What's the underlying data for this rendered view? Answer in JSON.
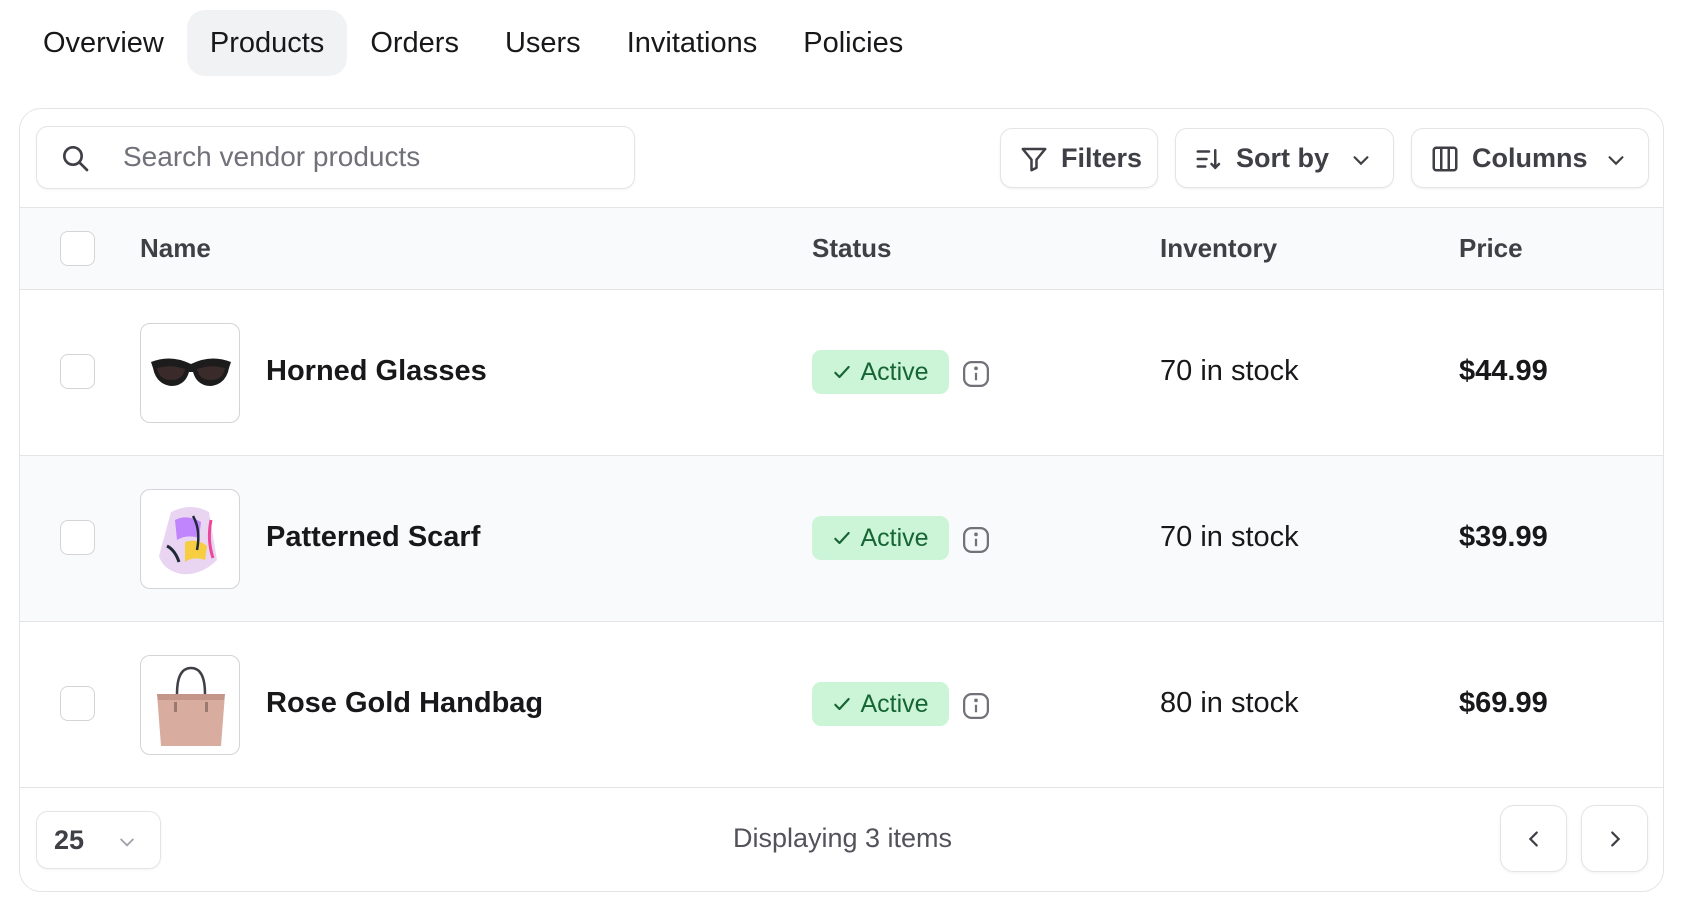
{
  "tabs": [
    {
      "label": "Overview",
      "active": false
    },
    {
      "label": "Products",
      "active": true
    },
    {
      "label": "Orders",
      "active": false
    },
    {
      "label": "Users",
      "active": false
    },
    {
      "label": "Invitations",
      "active": false
    },
    {
      "label": "Policies",
      "active": false
    }
  ],
  "toolbar": {
    "search_placeholder": "Search vendor products",
    "search_value": "",
    "filters_label": "Filters",
    "sort_label": "Sort by",
    "columns_label": "Columns"
  },
  "table": {
    "headers": {
      "name": "Name",
      "status": "Status",
      "inventory": "Inventory",
      "price": "Price"
    },
    "rows": [
      {
        "name": "Horned Glasses",
        "status": "Active",
        "inventory": "70 in stock",
        "price": "$44.99",
        "image_icon": "sunglasses-icon"
      },
      {
        "name": "Patterned Scarf",
        "status": "Active",
        "inventory": "70 in stock",
        "price": "$39.99",
        "image_icon": "scarf-icon"
      },
      {
        "name": "Rose Gold Handbag",
        "status": "Active",
        "inventory": "80 in stock",
        "price": "$69.99",
        "image_icon": "handbag-icon"
      }
    ]
  },
  "footer": {
    "per_page": "25",
    "display_text": "Displaying 3 items"
  },
  "colors": {
    "active_badge_bg": "#ccf5d8",
    "active_badge_text": "#166534",
    "active_tab_bg": "#f1f2f4",
    "border": "#e4e4e7"
  }
}
